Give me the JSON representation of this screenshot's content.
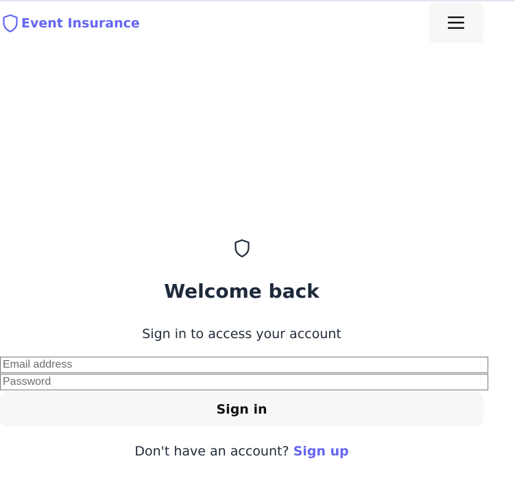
{
  "header": {
    "brand_label": "Event Insurance",
    "brand_icon": "shield-icon",
    "menu_icon": "hamburger-menu-icon"
  },
  "main": {
    "icon": "shield-icon",
    "title": "Welcome back",
    "subtitle": "Sign in to access your account",
    "email_placeholder": "Email address",
    "email_value": "",
    "password_placeholder": "Password",
    "password_value": "",
    "signin_label": "Sign in",
    "signup_prompt": "Don't have an account?",
    "signup_link": "Sign up"
  },
  "colors": {
    "accent": "#6366f1",
    "heading": "#1e293b",
    "button_bg": "#f7f7f7"
  }
}
